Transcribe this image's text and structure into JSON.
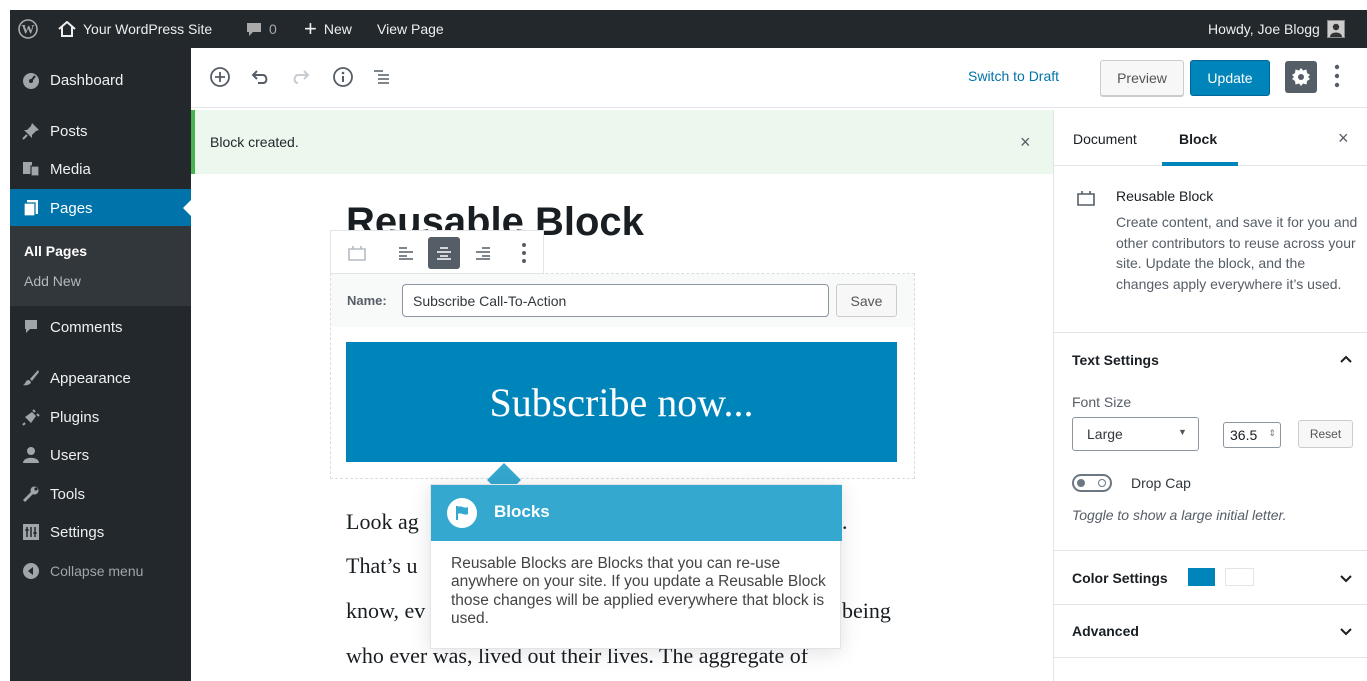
{
  "colors": {
    "admin_bar": "#23282d",
    "accent": "#0085ba",
    "menu_current": "#0073aa",
    "tooltip_header": "#35a8d0",
    "notice_border": "#46b450",
    "color_setting_swatch_1": "#0085ba",
    "color_setting_swatch_2": "#ffffff"
  },
  "admin_bar": {
    "wp_logo_icon": "wordpress-icon",
    "site_name": "Your WordPress Site",
    "comments_count": "0",
    "new_label": "New",
    "view_page_label": "View Page",
    "howdy": "Howdy, Joe Blogg"
  },
  "admin_menu": {
    "items": [
      {
        "label": "Dashboard",
        "icon": "dashboard-icon"
      },
      {
        "label": "Posts",
        "icon": "pin-icon"
      },
      {
        "label": "Media",
        "icon": "media-icon"
      },
      {
        "label": "Pages",
        "icon": "page-icon"
      },
      {
        "label": "Comments",
        "icon": "comment-icon"
      },
      {
        "label": "Appearance",
        "icon": "brush-icon"
      },
      {
        "label": "Plugins",
        "icon": "plugin-icon"
      },
      {
        "label": "Users",
        "icon": "user-icon"
      },
      {
        "label": "Tools",
        "icon": "wrench-icon"
      },
      {
        "label": "Settings",
        "icon": "settings-icon"
      },
      {
        "label": "Collapse menu",
        "icon": "collapse-icon"
      }
    ],
    "submenu": [
      "All Pages",
      "Add New"
    ]
  },
  "header": {
    "switch_to_draft": "Switch to Draft",
    "preview": "Preview",
    "update": "Update"
  },
  "notice": {
    "text": "Block created.",
    "close": "×"
  },
  "editor": {
    "title": "Reusable Block",
    "reusable": {
      "name_label": "Name:",
      "name_value": "Subscribe Call-To-Action",
      "save": "Save"
    },
    "cta_text": "Subscribe now...",
    "paragraph_lines": [
      "Look ag",
      "That’s u",
      "know, ev",
      "who ever was, lived out their lives. The aggregate of"
    ],
    "paragraph_line_ends": [
      "",
      "",
      "being"
    ]
  },
  "tooltip": {
    "title": "Blocks",
    "body": "Reusable Blocks are Blocks that you can re-use anywhere on your site. If you update a Reusable Block those changes will be applied everywhere that block is used."
  },
  "sidebar": {
    "tabs": [
      "Document",
      "Block"
    ],
    "active_tab": "Block",
    "close": "×",
    "block_title": "Reusable Block",
    "block_desc": "Create content, and save it for you and other contributors to reuse across your site. Update the block, and the changes apply everywhere it’s used.",
    "text_settings": {
      "title": "Text Settings",
      "font_size_label": "Font Size",
      "font_size_select": "Large",
      "font_size_value": "36.5",
      "reset": "Reset",
      "drop_cap_label": "Drop Cap",
      "drop_cap_help": "Toggle to show a large initial letter."
    },
    "color_settings": "Color Settings",
    "advanced": "Advanced"
  }
}
